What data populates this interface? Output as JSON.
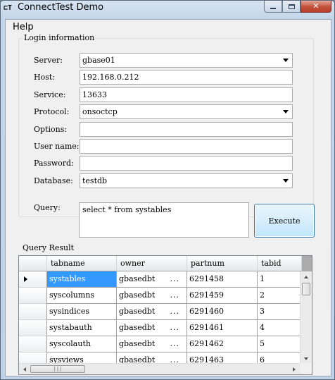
{
  "window": {
    "title": "ConnectTest Demo",
    "icon_text": "⊏T",
    "close_glyph": "✕"
  },
  "menu": {
    "help": "Help"
  },
  "login": {
    "legend": "Login information",
    "fields": [
      {
        "label": "Server:",
        "value": "gbase01",
        "type": "combo"
      },
      {
        "label": "Host:",
        "value": "192.168.0.212",
        "type": "text"
      },
      {
        "label": "Service:",
        "value": "13633",
        "type": "text"
      },
      {
        "label": "Protocol:",
        "value": "onsoctcp",
        "type": "combo"
      },
      {
        "label": "Options:",
        "value": "",
        "type": "text"
      },
      {
        "label": "User name:",
        "value": "",
        "type": "text"
      },
      {
        "label": "Password:",
        "value": "",
        "type": "text"
      },
      {
        "label": "Database:",
        "value": "testdb",
        "type": "combo"
      }
    ]
  },
  "query": {
    "label": "Query:",
    "text": "select * from systables",
    "execute_label": "Execute"
  },
  "result": {
    "title": "Query Result",
    "columns": [
      "tabname",
      "owner",
      "partnum",
      "tabid"
    ],
    "rows": [
      [
        "systables",
        "gbasedbt",
        "6291458",
        "1"
      ],
      [
        "syscolumns",
        "gbasedbt",
        "6291459",
        "2"
      ],
      [
        "sysindices",
        "gbasedbt",
        "6291460",
        "3"
      ],
      [
        "systabauth",
        "gbasedbt",
        "6291461",
        "4"
      ],
      [
        "syscolauth",
        "gbasedbt",
        "6291462",
        "5"
      ],
      [
        "sysviews",
        "gbasedbt",
        "6291463",
        "6"
      ]
    ],
    "truncation_marker": "...",
    "selected_row": 0,
    "hscroll_grip": "|||"
  }
}
